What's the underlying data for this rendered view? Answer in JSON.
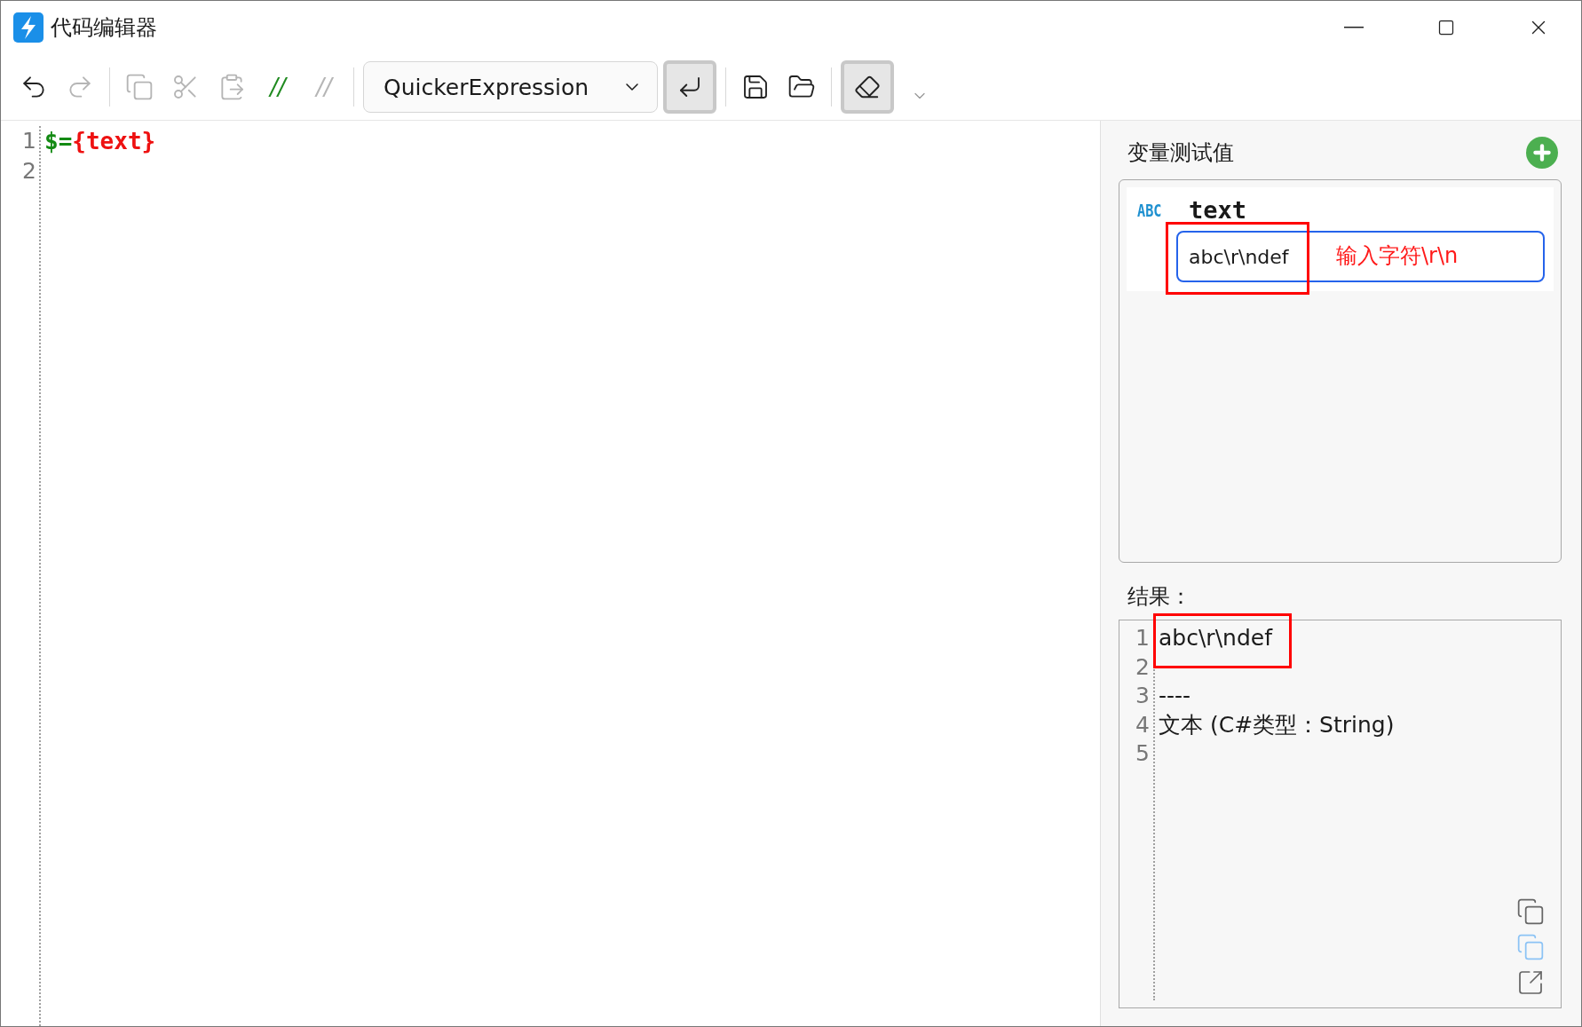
{
  "window": {
    "title": "代码编辑器"
  },
  "toolbar": {
    "items": [
      {
        "kind": "undo",
        "disabled": false
      },
      {
        "kind": "redo",
        "disabled": true
      },
      {
        "kind": "separator"
      },
      {
        "kind": "copy",
        "disabled": true
      },
      {
        "kind": "cut",
        "disabled": true
      },
      {
        "kind": "paste",
        "disabled": true
      },
      {
        "kind": "comment",
        "label": "//",
        "disabled": false
      },
      {
        "kind": "uncomment",
        "label": "//",
        "disabled": true
      },
      {
        "kind": "separator"
      },
      {
        "kind": "combo",
        "value": "QuickerExpression"
      },
      {
        "kind": "wrap",
        "on": true
      },
      {
        "kind": "separator"
      },
      {
        "kind": "save",
        "disabled": false
      },
      {
        "kind": "open",
        "disabled": false
      },
      {
        "kind": "separator"
      },
      {
        "kind": "pen",
        "on": true
      },
      {
        "kind": "more",
        "disabled": false
      }
    ]
  },
  "editor": {
    "lines": [
      {
        "number": "1",
        "tokens": [
          {
            "text": "$=",
            "kind": "operator"
          },
          {
            "text": "{text}",
            "kind": "variable"
          }
        ]
      },
      {
        "number": "2"
      }
    ]
  },
  "variables_panel": {
    "title": "变量测试值",
    "variables": [
      {
        "type_badge": "ABC",
        "name": "text",
        "value": "abc\\r\\ndef",
        "highlighted": true,
        "annotation": "输入字符\\r\\n"
      }
    ]
  },
  "result": {
    "title": "结果：",
    "lines": [
      {
        "number": "1",
        "text": "abc\\r\\ndef",
        "highlighted": true
      },
      {
        "number": "2",
        "highlighted": false
      },
      {
        "number": "3",
        "text": "----",
        "highlighted": false
      },
      {
        "number": "4",
        "text": "文本 (C#类型：String)",
        "highlighted": false
      },
      {
        "number": "5",
        "highlighted": false
      }
    ]
  }
}
